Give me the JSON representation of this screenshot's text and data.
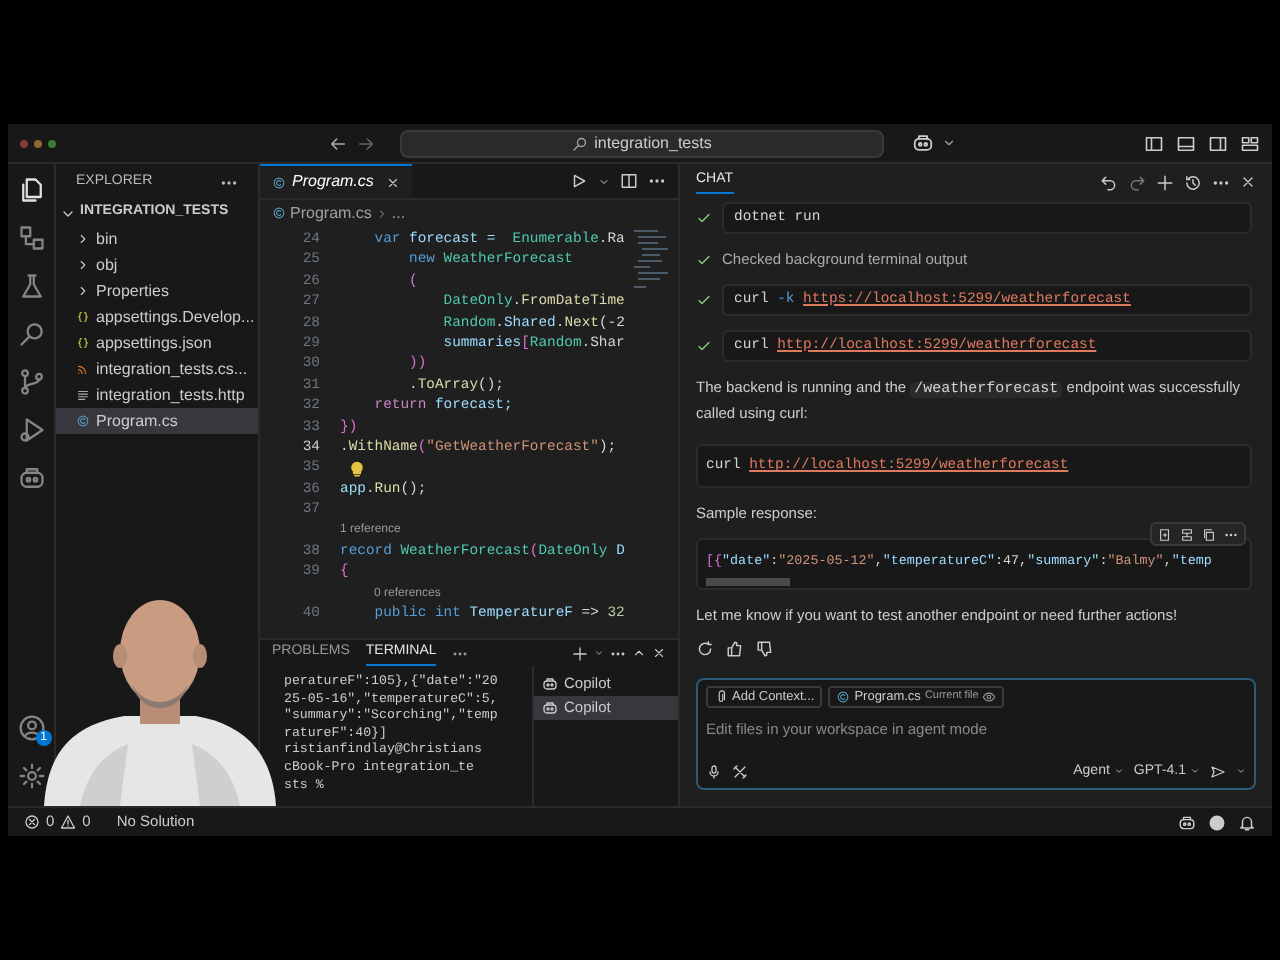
{
  "title_bar": {
    "search": "integration_tests"
  },
  "activity_bar": {
    "items": [
      {
        "kind": "files",
        "selected": true
      },
      {
        "kind": "remote",
        "selected": false
      },
      {
        "kind": "testing",
        "selected": false
      },
      {
        "kind": "search",
        "selected": false
      },
      {
        "kind": "source-control",
        "selected": false
      },
      {
        "kind": "run",
        "selected": false
      },
      {
        "kind": "copilot",
        "selected": false
      }
    ],
    "account_badge": "1"
  },
  "explorer": {
    "title": "EXPLORER",
    "tree": {
      "label": "INTEGRATION_TESTS",
      "expanded": true,
      "children": [
        {
          "label": "bin",
          "kind": "folder",
          "expanded": false,
          "selected": false
        },
        {
          "label": "obj",
          "kind": "folder",
          "expanded": false,
          "selected": false
        },
        {
          "label": "Properties",
          "kind": "folder",
          "expanded": false,
          "selected": false
        },
        {
          "label": "appsettings.Develop...",
          "kind": "json",
          "selected": false
        },
        {
          "label": "appsettings.json",
          "kind": "json",
          "selected": false
        },
        {
          "label": "integration_tests.cs...",
          "kind": "csproj",
          "selected": false
        },
        {
          "label": "integration_tests.http",
          "kind": "http",
          "selected": false
        },
        {
          "label": "Program.cs",
          "kind": "cs",
          "selected": true
        }
      ]
    }
  },
  "editor": {
    "tab": {
      "label": "Program.cs"
    },
    "breadcrumb": [
      "Program.cs",
      "..."
    ],
    "lines": [
      {
        "kind": "code",
        "number": "24",
        "current": false,
        "tokens": [
          {
            "text": "    var",
            "kind": "k"
          },
          {
            "text": " forecast =  ",
            "kind": "v"
          },
          {
            "text": "Enumerable",
            "kind": "t"
          },
          {
            "text": ".Ra",
            "kind": "p"
          }
        ]
      },
      {
        "kind": "code",
        "number": "25",
        "current": false,
        "tokens": [
          {
            "text": "        new ",
            "kind": "k"
          },
          {
            "text": "WeatherForecast",
            "kind": "t"
          }
        ]
      },
      {
        "kind": "code",
        "number": "26",
        "current": false,
        "tokens": [
          {
            "text": "        (",
            "kind": "y"
          }
        ]
      },
      {
        "kind": "code",
        "number": "27",
        "current": false,
        "tokens": [
          {
            "text": "            DateOnly",
            "kind": "t"
          },
          {
            "text": ".",
            "kind": "p"
          },
          {
            "text": "FromDateTime",
            "kind": "f"
          }
        ]
      },
      {
        "kind": "code",
        "number": "28",
        "current": false,
        "tokens": [
          {
            "text": "            Random",
            "kind": "t"
          },
          {
            "text": ".",
            "kind": "p"
          },
          {
            "text": "Shared",
            "kind": "v"
          },
          {
            "text": ".",
            "kind": "p"
          },
          {
            "text": "Next",
            "kind": "f"
          },
          {
            "text": "(-2",
            "kind": "p"
          }
        ]
      },
      {
        "kind": "code",
        "number": "29",
        "current": false,
        "tokens": [
          {
            "text": "            summaries",
            "kind": "v"
          },
          {
            "text": "[",
            "kind": "y"
          },
          {
            "text": "Random",
            "kind": "t"
          },
          {
            "text": ".Shar",
            "kind": "p"
          }
        ]
      },
      {
        "kind": "code",
        "number": "30",
        "current": false,
        "tokens": [
          {
            "text": "        ))",
            "kind": "y"
          }
        ]
      },
      {
        "kind": "code",
        "number": "31",
        "current": false,
        "tokens": [
          {
            "text": "        .",
            "kind": "p"
          },
          {
            "text": "ToArray",
            "kind": "f"
          },
          {
            "text": "();",
            "kind": "p"
          }
        ]
      },
      {
        "kind": "code",
        "number": "32",
        "current": false,
        "tokens": [
          {
            "text": "    return",
            "kind": "c"
          },
          {
            "text": " forecast;",
            "kind": "v"
          }
        ]
      },
      {
        "kind": "code",
        "number": "33",
        "current": false,
        "tokens": [
          {
            "text": "})",
            "kind": "y"
          }
        ]
      },
      {
        "kind": "code",
        "number": "34",
        "current": true,
        "tokens": [
          {
            "text": ".",
            "kind": "p"
          },
          {
            "text": "WithName",
            "kind": "f"
          },
          {
            "text": "(",
            "kind": "y"
          },
          {
            "text": "\"GetWeatherForecast\"",
            "kind": "s"
          },
          {
            "text": ");",
            "kind": "p"
          }
        ]
      },
      {
        "kind": "lightbulb",
        "number": "35",
        "current": false
      },
      {
        "kind": "code",
        "number": "36",
        "current": false,
        "tokens": [
          {
            "text": "app",
            "kind": "v"
          },
          {
            "text": ".",
            "kind": "p"
          },
          {
            "text": "Run",
            "kind": "f"
          },
          {
            "text": "();",
            "kind": "p"
          }
        ]
      },
      {
        "kind": "code",
        "number": "37",
        "current": false
      },
      {
        "kind": "lens",
        "text": "1 reference"
      },
      {
        "kind": "code",
        "number": "38",
        "current": false,
        "tokens": [
          {
            "text": "record ",
            "kind": "k"
          },
          {
            "text": "WeatherForecast",
            "kind": "t"
          },
          {
            "text": "(",
            "kind": "y"
          },
          {
            "text": "DateOnly",
            "kind": "t"
          },
          {
            "text": " D",
            "kind": "v"
          }
        ]
      },
      {
        "kind": "code",
        "number": "39",
        "current": false,
        "tokens": [
          {
            "text": "{",
            "kind": "y"
          }
        ]
      },
      {
        "kind": "lens",
        "text": "0 references"
      },
      {
        "kind": "code",
        "number": "40",
        "current": false,
        "tokens": [
          {
            "text": "    public int ",
            "kind": "k"
          },
          {
            "text": "TemperatureF",
            "kind": "v"
          },
          {
            "text": " => ",
            "kind": "p"
          },
          {
            "text": "32",
            "kind": "n"
          }
        ]
      }
    ]
  },
  "panel": {
    "tabs": [
      {
        "label": "PROBLEMS",
        "selected": false
      },
      {
        "label": "TERMINAL",
        "selected": true
      }
    ],
    "terminal_lines": [
      "peratureF\":105},{\"date\":\"20",
      "25-05-16\",\"temperatureC\":5,",
      "\"summary\":\"Scorching\",\"temp",
      "ratureF\":40}]",
      "ristianfindlay@Christians",
      "cBook-Pro integration_te",
      "sts %"
    ],
    "terminals": [
      {
        "label": "Copilot",
        "selected": false
      },
      {
        "label": "Copilot",
        "selected": true
      }
    ]
  },
  "chat": {
    "title": "CHAT",
    "items": [
      {
        "kind": "command",
        "tokens": [
          {
            "text": "dotnet run",
            "kind": "p"
          }
        ]
      },
      {
        "kind": "status",
        "text": "Checked background terminal output"
      },
      {
        "kind": "command",
        "tokens": [
          {
            "text": "curl ",
            "kind": "p"
          },
          {
            "text": "-k ",
            "kind": "k"
          },
          {
            "text": "https://localhost:5299/weatherforecast",
            "kind": "link"
          }
        ]
      },
      {
        "kind": "command",
        "tokens": [
          {
            "text": "curl ",
            "kind": "p"
          },
          {
            "text": "http://localhost:5299/weatherforecast",
            "kind": "link"
          }
        ]
      },
      {
        "kind": "paragraph",
        "parts": [
          {
            "text": "The backend is running and the ",
            "code": false
          },
          {
            "text": "/weatherforecast",
            "code": true
          },
          {
            "text": " endpoint was successfully called using curl:",
            "code": false
          }
        ]
      },
      {
        "kind": "code",
        "toolbar": false,
        "tokens": [
          {
            "text": "curl ",
            "kind": "p"
          },
          {
            "text": "http://localhost:5299/weatherforecast",
            "kind": "link"
          }
        ]
      },
      {
        "kind": "paragraph",
        "parts": [
          {
            "text": "Sample response:",
            "code": false
          }
        ]
      },
      {
        "kind": "code",
        "toolbar": true,
        "tokens": [
          {
            "text": "[{",
            "kind": "y"
          },
          {
            "text": "\"date\"",
            "kind": "v"
          },
          {
            "text": ":",
            "kind": "p"
          },
          {
            "text": "\"2025-05-12\"",
            "kind": "s"
          },
          {
            "text": ",",
            "kind": "p"
          },
          {
            "text": "\"temperatureC\"",
            "kind": "v"
          },
          {
            "text": ":47,",
            "kind": "p"
          },
          {
            "text": "\"summary\"",
            "kind": "v"
          },
          {
            "text": ":",
            "kind": "p"
          },
          {
            "text": "\"Balmy\"",
            "kind": "s"
          },
          {
            "text": ",",
            "kind": "p"
          },
          {
            "text": "\"temp",
            "kind": "v"
          }
        ]
      },
      {
        "kind": "paragraph",
        "parts": [
          {
            "text": "Let me know if you want to test another endpoint or need further actions!",
            "code": false
          }
        ]
      },
      {
        "kind": "feedback"
      }
    ],
    "input": {
      "chips": [
        {
          "kind": "add-context",
          "label": "Add Context..."
        },
        {
          "kind": "file",
          "label": "Program.cs",
          "note": "Current file"
        }
      ],
      "placeholder": "Edit files in your workspace in agent mode",
      "mode": "Agent",
      "model": "GPT-4.1"
    }
  },
  "status_bar": {
    "errors": "0",
    "warnings": "0",
    "solution": "No Solution"
  }
}
